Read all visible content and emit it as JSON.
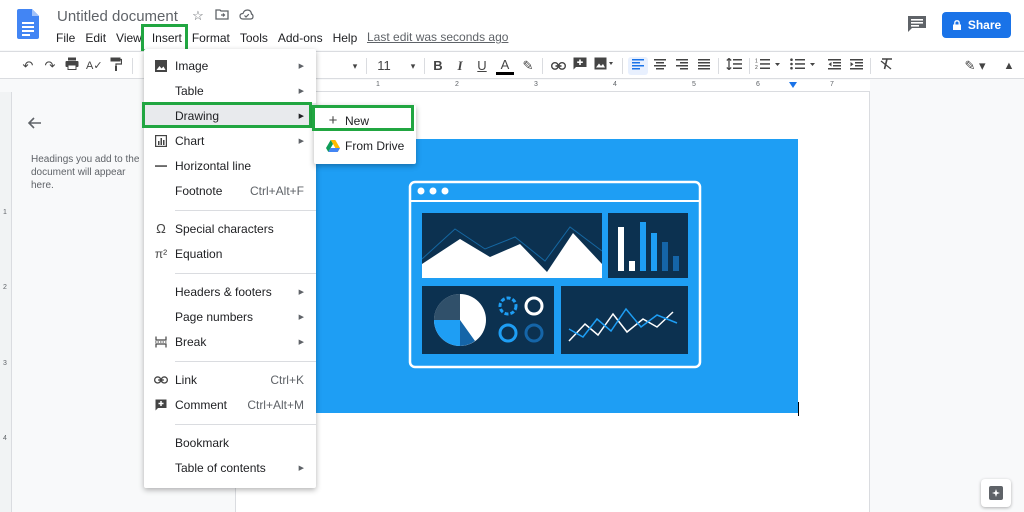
{
  "header": {
    "title": "Untitled document",
    "last_edit": "Last edit was seconds ago",
    "share_label": "Share"
  },
  "menubar": {
    "items": [
      "File",
      "Edit",
      "View",
      "Insert",
      "Format",
      "Tools",
      "Add-ons",
      "Help"
    ]
  },
  "toolbar": {
    "font_size": "11",
    "bold": "B",
    "italic": "I",
    "underline": "U",
    "text_color": "A"
  },
  "ruler": {
    "h_numbers": [
      "1",
      "2",
      "3",
      "4",
      "5",
      "6",
      "7"
    ],
    "v_numbers": [
      "1",
      "2",
      "3",
      "4"
    ]
  },
  "outline": {
    "hint": "Headings you add to the document will appear here."
  },
  "insert_menu": {
    "image": "Image",
    "table": "Table",
    "drawing": "Drawing",
    "chart": "Chart",
    "horizontal_line": "Horizontal line",
    "footnote": "Footnote",
    "footnote_shortcut": "Ctrl+Alt+F",
    "special_characters": "Special characters",
    "equation": "Equation",
    "headers_footers": "Headers & footers",
    "page_numbers": "Page numbers",
    "break": "Break",
    "link": "Link",
    "link_shortcut": "Ctrl+K",
    "comment": "Comment",
    "comment_shortcut": "Ctrl+Alt+M",
    "bookmark": "Bookmark",
    "table_of_contents": "Table of contents"
  },
  "drawing_submenu": {
    "new": "New",
    "from_drive": "From Drive"
  },
  "colors": {
    "accent": "#1a73e8",
    "highlight_box": "#21a641",
    "image_bg": "#1e9ef4",
    "image_dark": "#0c3150"
  }
}
